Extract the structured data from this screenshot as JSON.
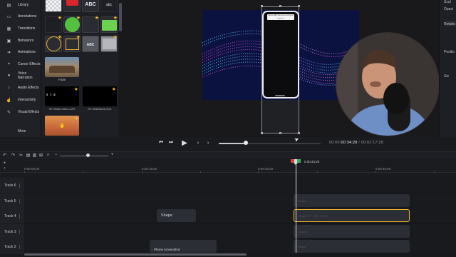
{
  "tools": [
    {
      "label": "Library",
      "icon": "library-icon",
      "glyph": "▤"
    },
    {
      "label": "Annotations",
      "icon": "annotations-icon",
      "glyph": "▭"
    },
    {
      "label": "Transitions",
      "icon": "transitions-icon",
      "glyph": "▦"
    },
    {
      "label": "Behaviors",
      "icon": "behaviors-icon",
      "glyph": "▣"
    },
    {
      "label": "Animations",
      "icon": "animations-icon",
      "glyph": "➜"
    },
    {
      "label": "Cursor Effects",
      "icon": "cursor-effects-icon",
      "glyph": "⌖"
    },
    {
      "label": "Voice Narration",
      "icon": "voice-narration-icon",
      "glyph": "🎙"
    },
    {
      "label": "Audio Effects",
      "icon": "audio-effects-icon",
      "glyph": "♪"
    },
    {
      "label": "Interactivity",
      "icon": "interactivity-icon",
      "glyph": "☝"
    },
    {
      "label": "Visual Effects",
      "icon": "visual-effects-icon",
      "glyph": "✎"
    },
    {
      "label": "More",
      "icon": "more-icon",
      "glyph": ""
    }
  ],
  "bin": {
    "thumb_text_abc": "ABC",
    "thumb_text_abc_small": "ABC",
    "thumb_text_small": "abc",
    "thumb_text_cursive": "abc",
    "fade_label": "Fade",
    "text_preview": "s  i  a",
    "item_sliding_letters": "SF-SlideLetters-L2R",
    "item_slide_block": "SF-SlideBlock-R2L"
  },
  "canvas": {
    "phone_note": "Find the SAVE button in your settings to bookmark"
  },
  "properties": {
    "scale_label": "Scal",
    "opacity_label": "Opaci",
    "rotation_label": "Rotatio",
    "position_label": "Positio",
    "size_label": "Siz"
  },
  "playback": {
    "current_time": "00:34;28",
    "total_time": "02:17;28",
    "progress": 0.25
  },
  "timeline": {
    "ruler": [
      "0:00:00;00",
      "0:00:15;00",
      "0:00:30;00",
      "0:00:45;00"
    ],
    "playhead_label": "0:00:34;28",
    "tracks": [
      {
        "name": "Track 6"
      },
      {
        "name": "Track 5",
        "clips": [
          {
            "label": "Shape",
            "ghost": true
          }
        ]
      },
      {
        "name": "Track 4",
        "clips": [
          {
            "label": "Shape",
            "ghost": false
          },
          {
            "label": "Shape SF - NE...SLEN",
            "ghost": true,
            "selected": true
          }
        ]
      },
      {
        "name": "Track 3",
        "clips": [
          {
            "label": "Callout",
            "ghost": true
          }
        ]
      },
      {
        "name": "Track 2",
        "clips": [
          {
            "label": "Phone screenshot",
            "ghost": false
          },
          {
            "label": "Phone",
            "ghost": true
          }
        ]
      }
    ]
  },
  "colors": {
    "accent": "#f2b52c",
    "playhead_marker": "#3fa66b",
    "selection": "#f2b52c"
  }
}
